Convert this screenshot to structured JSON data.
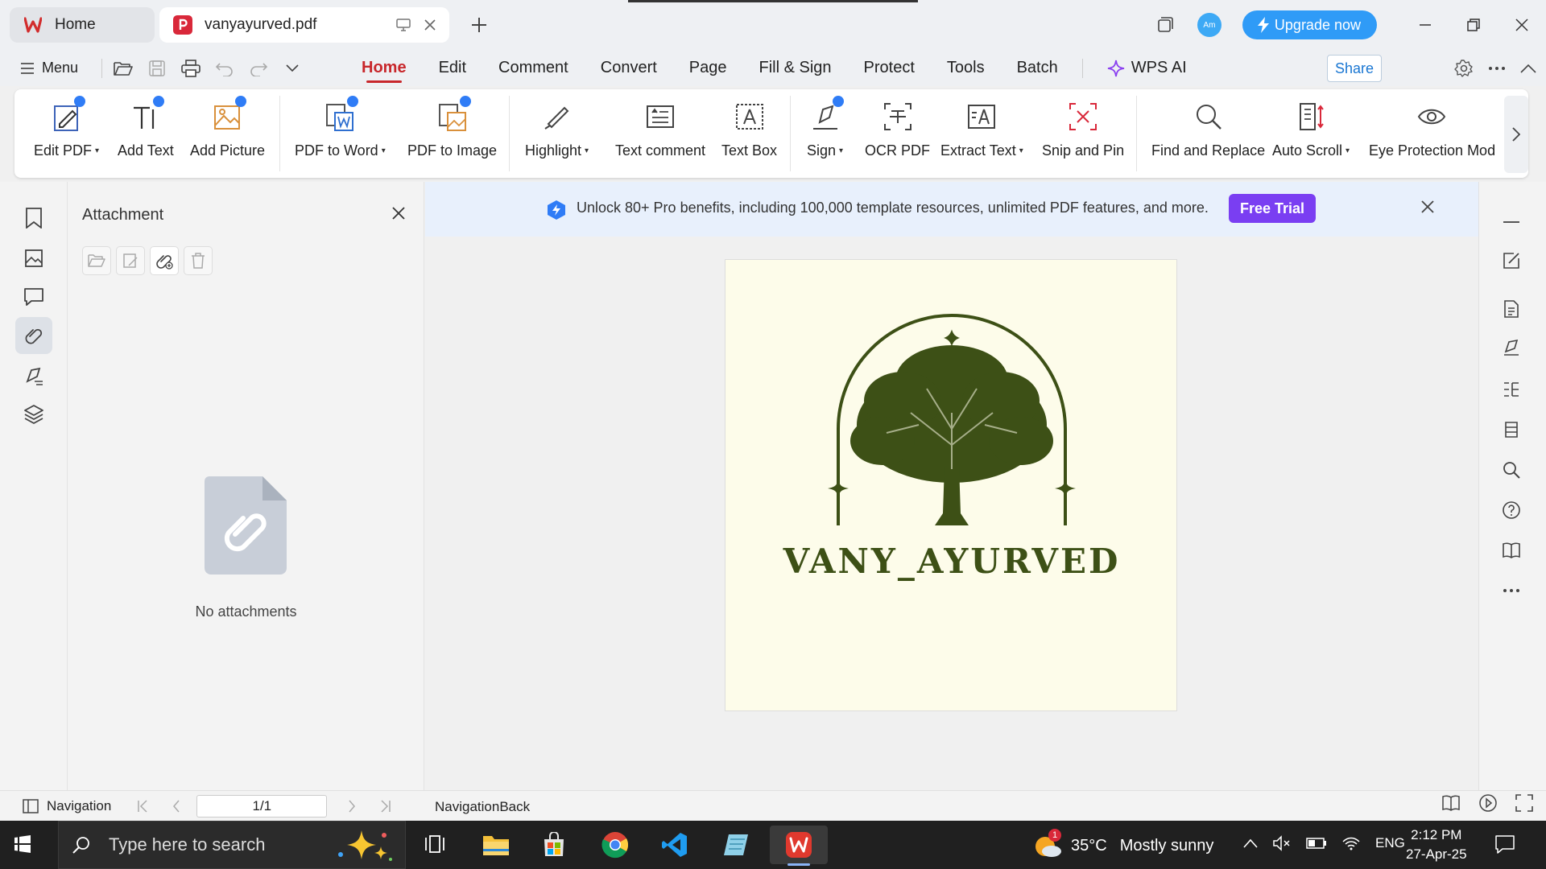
{
  "titlebar": {
    "home_tab": "Home",
    "doc_tab": "vanyayurved.pdf",
    "avatar_text": "Am",
    "upgrade_label": "Upgrade now"
  },
  "menubar": {
    "menu_label": "Menu",
    "tabs": [
      "Home",
      "Edit",
      "Comment",
      "Convert",
      "Page",
      "Fill & Sign",
      "Protect",
      "Tools",
      "Batch"
    ],
    "active_tab": "Home",
    "wps_ai": "WPS AI",
    "share": "Share"
  },
  "ribbon": {
    "edit_pdf": "Edit PDF",
    "add_text": "Add Text",
    "add_picture": "Add Picture",
    "pdf_to_word": "PDF to Word",
    "pdf_to_image": "PDF to Image",
    "highlight": "Highlight",
    "text_comment": "Text comment",
    "text_box": "Text Box",
    "sign": "Sign",
    "ocr_pdf": "OCR PDF",
    "extract_text": "Extract Text",
    "snip_and_pin": "Snip and Pin",
    "find_and_replace": "Find and Replace",
    "auto_scroll": "Auto Scroll",
    "eye_protection": "Eye Protection Mod"
  },
  "attachment_panel": {
    "title": "Attachment",
    "empty_text": "No attachments"
  },
  "promo": {
    "text": "Unlock 80+ Pro benefits, including 100,000 template resources, unlimited PDF features, and more.",
    "button": "Free Trial"
  },
  "document": {
    "brand_text": "VANY_AYURVED",
    "accent_color": "#3d5016",
    "page_background": "#fdfcea"
  },
  "statusbar": {
    "navigation": "Navigation",
    "page_indicator": "1/1",
    "navigation_back": "NavigationBack"
  },
  "taskbar": {
    "search_placeholder": "Type here to search",
    "weather_temp": "35°C",
    "weather_desc": "Mostly sunny",
    "weather_badge": "1",
    "language": "ENG",
    "time": "2:12 PM",
    "date": "27-Apr-25"
  },
  "colors": {
    "active_tab": "#c8272b",
    "upgrade_button": "#2f9bf7",
    "free_trial": "#7a3ef2",
    "promo_bg": "#e8f0fc"
  }
}
